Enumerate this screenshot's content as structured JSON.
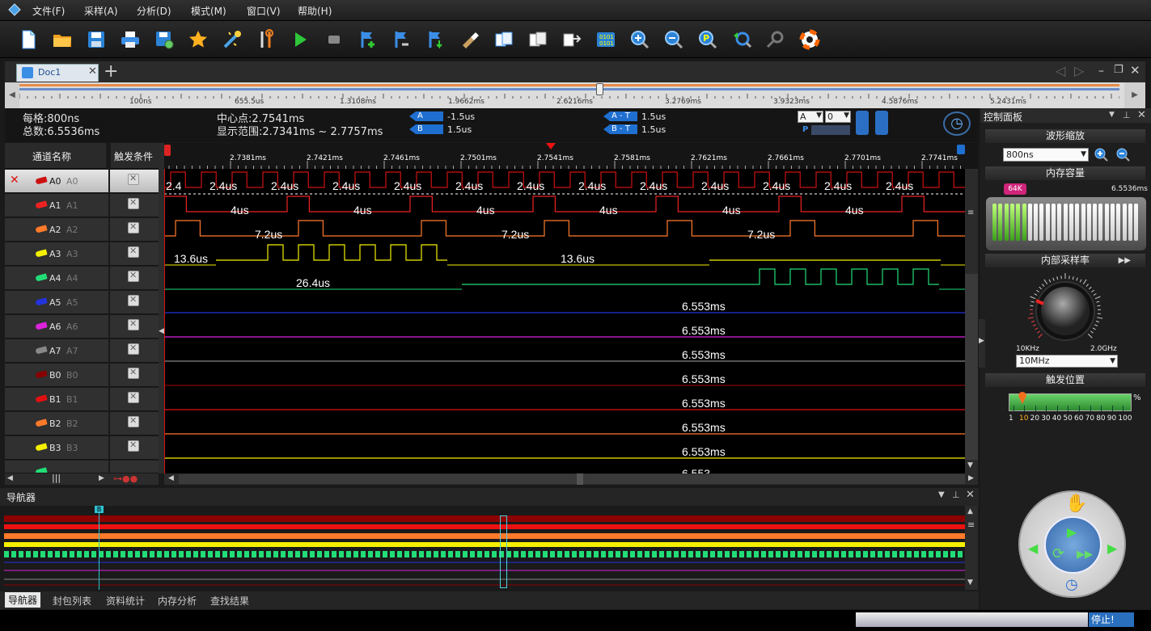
{
  "menu": [
    "文件(F)",
    "采样(A)",
    "分析(D)",
    "模式(M)",
    "窗口(V)",
    "帮助(H)"
  ],
  "tab": {
    "label": "Doc1",
    "add": "+"
  },
  "ruler": {
    "ticks": [
      "100ns",
      "655.5us",
      "1.3108ms",
      "1.9662ms",
      "2.6216ms",
      "3.2769ms",
      "3.9323ms",
      "4.5876ms",
      "5.2431ms"
    ]
  },
  "info": {
    "per_div": "每格:800ns",
    "total": "总数:6.5536ms",
    "center": "中心点:2.7541ms",
    "range": "显示范围:2.7341ms ~ 2.7757ms",
    "apos_label": "A Pos",
    "apos_val": "-1.5us",
    "bpos_label": "B Pos",
    "bpos_val": "1.5us",
    "at_label": "A - T",
    "at_val": "1.5us",
    "bt_label": "B - T",
    "bt_val": "1.5us",
    "sel_a": "A",
    "sel_0": "0",
    "p": "P"
  },
  "channels": {
    "header_name": "通道名称",
    "header_trig": "触发条件",
    "list": [
      {
        "name": "A0",
        "alias": "A0",
        "color": "#cc1111"
      },
      {
        "name": "A1",
        "alias": "A1",
        "color": "#ee2222"
      },
      {
        "name": "A2",
        "alias": "A2",
        "color": "#ff7a2a"
      },
      {
        "name": "A3",
        "alias": "A3",
        "color": "#f4f000"
      },
      {
        "name": "A4",
        "alias": "A4",
        "color": "#22dd77"
      },
      {
        "name": "A5",
        "alias": "A5",
        "color": "#2233dd"
      },
      {
        "name": "A6",
        "alias": "A6",
        "color": "#dd22dd"
      },
      {
        "name": "A7",
        "alias": "A7",
        "color": "#888888"
      },
      {
        "name": "B0",
        "alias": "B0",
        "color": "#880000"
      },
      {
        "name": "B1",
        "alias": "B1",
        "color": "#dd1111"
      },
      {
        "name": "B2",
        "alias": "B2",
        "color": "#ff7a2a"
      },
      {
        "name": "B3",
        "alias": "B3",
        "color": "#f4f000"
      }
    ]
  },
  "time_axis": [
    "2.7381ms",
    "2.7421ms",
    "2.7461ms",
    "2.7501ms",
    "2.7541ms",
    "2.7581ms",
    "2.7621ms",
    "2.7661ms",
    "2.7701ms",
    "2.7741ms"
  ],
  "wave_labels": {
    "a0": "2.4us",
    "a0_first": "2.4",
    "a1": "4us",
    "a2": "7.2us",
    "a3": "13.6us",
    "a4": "26.4us",
    "flat": "6.553ms",
    "flat_partial": "6.553"
  },
  "navigator": {
    "title": "导航器",
    "cursor": "B"
  },
  "bottom_tabs": [
    "导航器",
    "封包列表",
    "资料统计",
    "内存分析",
    "查找结果"
  ],
  "control": {
    "title": "控制面板",
    "zoom_title": "波形缩放",
    "zoom_value": "800ns",
    "mem_title": "内存容量",
    "mem_badge": "64K",
    "mem_value": "6.5536ms",
    "mem_level": 0.22,
    "rate_title": "内部采样率",
    "rate_min": "10KHz",
    "rate_max": "2.0GHz",
    "rate_value": "10MHz",
    "trig_title": "触发位置",
    "trig_percent": "%",
    "trig_ticks": [
      "1",
      "10",
      "20",
      "30",
      "40",
      "50",
      "60",
      "70",
      "80",
      "90",
      "100"
    ],
    "trig_selected": "10"
  },
  "status": {
    "stop": "停止!"
  }
}
